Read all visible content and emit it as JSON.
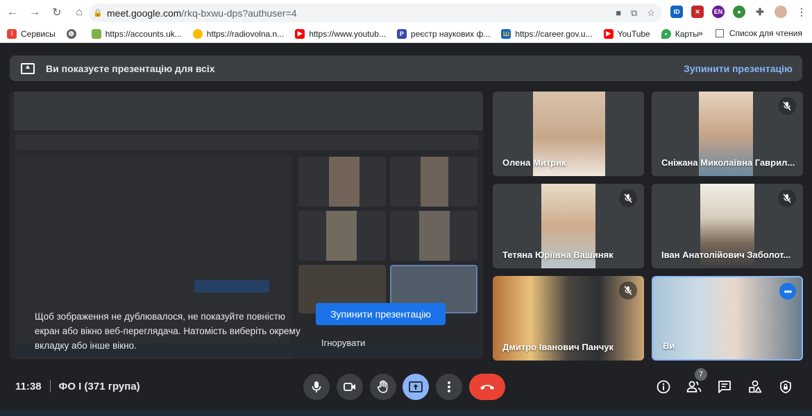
{
  "browser": {
    "url_host": "meet.google.com",
    "url_path": "/rkq-bxwu-dps?authuser=4",
    "bookmarks": [
      {
        "label": "Сервисы",
        "icon": "apps-icon",
        "color": "#ea4335"
      },
      {
        "label": "",
        "icon": "globe-icon",
        "color": "#5f6368"
      },
      {
        "label": "https://accounts.uk...",
        "icon": "accounts-icon",
        "color": "#7cb342"
      },
      {
        "label": "https://radiovolna.n...",
        "icon": "radio-icon",
        "color": "#fbbc04"
      },
      {
        "label": "https://www.youtub...",
        "icon": "youtube-icon",
        "color": "#ff0000"
      },
      {
        "label": "реєстр наукових ф...",
        "icon": "p-icon",
        "color": "#3949ab"
      },
      {
        "label": "https://career.gov.u...",
        "icon": "trident-icon",
        "color": "#1565c0"
      },
      {
        "label": "YouTube",
        "icon": "youtube-icon",
        "color": "#ff0000"
      },
      {
        "label": "Карты",
        "icon": "maps-icon",
        "color": "#34a853"
      }
    ],
    "overflow": "»",
    "reading_list": "Список для чтения"
  },
  "banner": {
    "text": "Ви показуєте презентацію для всіх",
    "stop_label": "Зупинити презентацію"
  },
  "presenting_overlay": {
    "warning": "Щоб зображення не дублювалося, не показуйте повністю екран або вікно веб-переглядача. Натомість виберіть окрему вкладку або інше вікно.",
    "stop_button": "Зупинити презентацію",
    "ignore_button": "Ігнорувати"
  },
  "participants": [
    {
      "name": "Олена Митрик",
      "muted": false
    },
    {
      "name": "Сніжана Миколаївна Гаврил...",
      "muted": true
    },
    {
      "name": "Тетяна Юріївна Вашиняк",
      "muted": true
    },
    {
      "name": "Іван Анатолійович Заболот...",
      "muted": true
    },
    {
      "name": "Дмитро Іванович Панчук",
      "muted": true
    },
    {
      "name": "Ви",
      "muted": false
    }
  ],
  "meeting": {
    "time": "11:38",
    "title": "ФО І (371 група)",
    "participant_count": "7"
  }
}
